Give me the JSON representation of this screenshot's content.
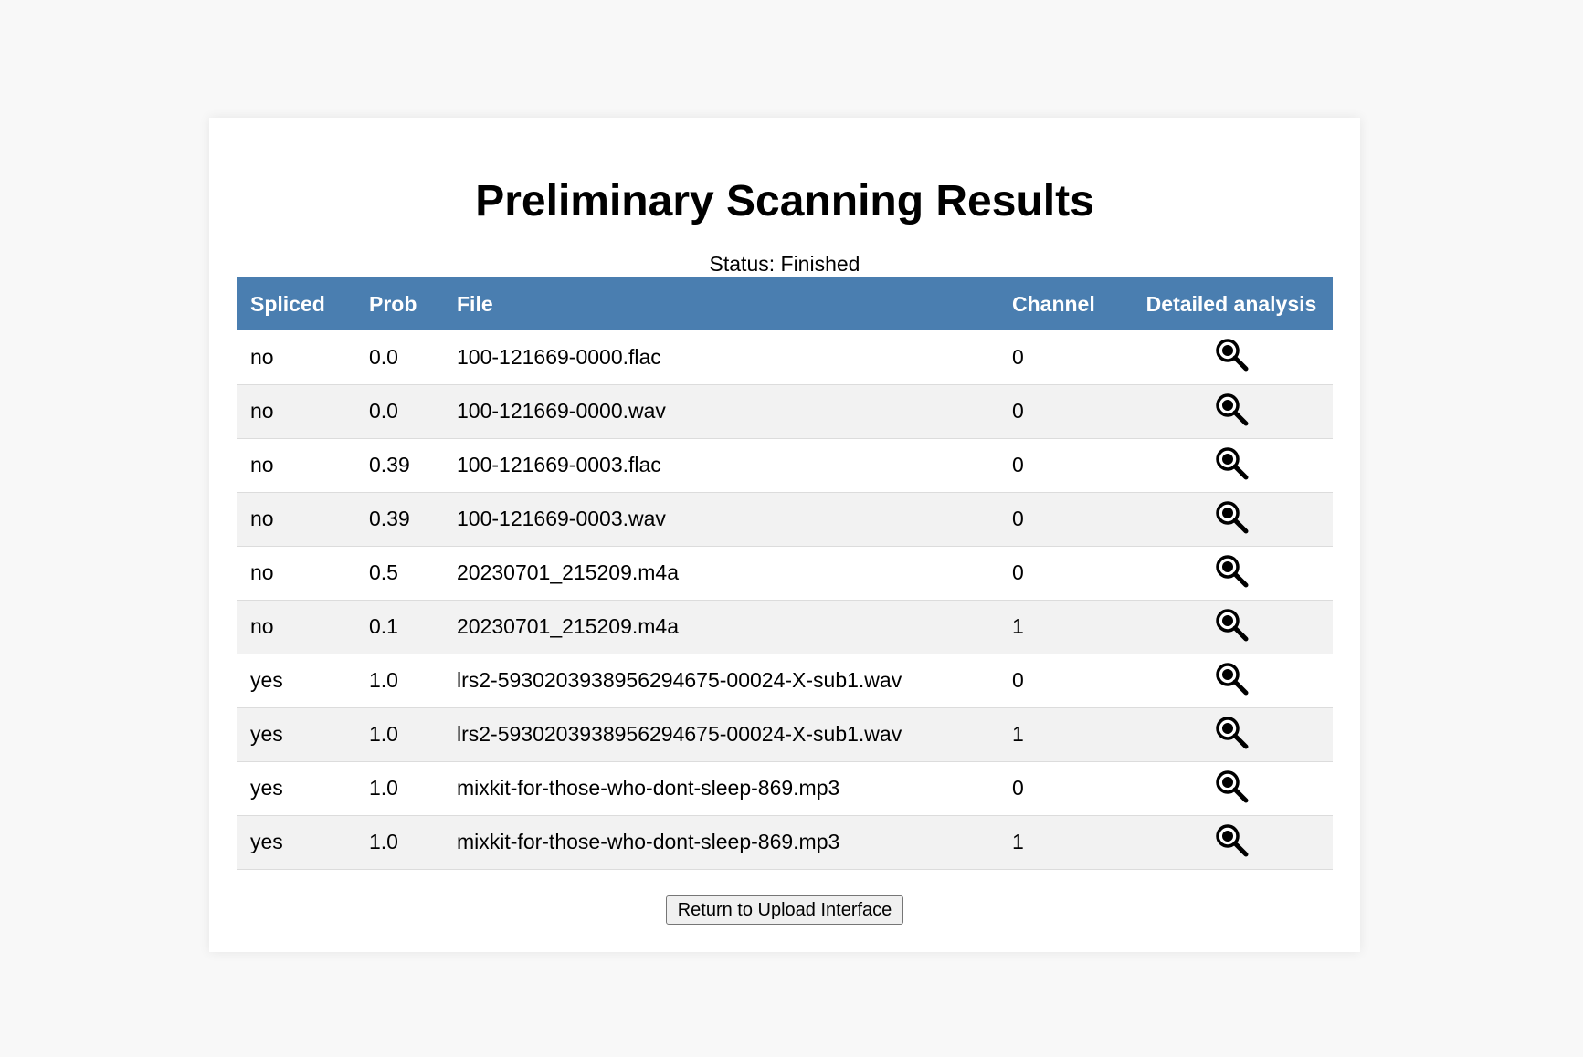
{
  "page": {
    "title": "Preliminary Scanning Results",
    "status": "Status: Finished"
  },
  "table": {
    "headers": {
      "spliced": "Spliced",
      "prob": "Prob",
      "file": "File",
      "channel": "Channel",
      "detailed": "Detailed analysis"
    },
    "rows": [
      {
        "spliced": "no",
        "prob": "0.0",
        "file": "100-121669-0000.flac",
        "channel": "0",
        "icon": "magnifier-icon"
      },
      {
        "spliced": "no",
        "prob": "0.0",
        "file": "100-121669-0000.wav",
        "channel": "0",
        "icon": "magnifier-icon"
      },
      {
        "spliced": "no",
        "prob": "0.39",
        "file": "100-121669-0003.flac",
        "channel": "0",
        "icon": "magnifier-icon"
      },
      {
        "spliced": "no",
        "prob": "0.39",
        "file": "100-121669-0003.wav",
        "channel": "0",
        "icon": "magnifier-icon"
      },
      {
        "spliced": "no",
        "prob": "0.5",
        "file": "20230701_215209.m4a",
        "channel": "0",
        "icon": "magnifier-icon"
      },
      {
        "spliced": "no",
        "prob": "0.1",
        "file": "20230701_215209.m4a",
        "channel": "1",
        "icon": "magnifier-icon"
      },
      {
        "spliced": "yes",
        "prob": "1.0",
        "file": "lrs2-5930203938956294675-00024-X-sub1.wav",
        "channel": "0",
        "icon": "magnifier-icon"
      },
      {
        "spliced": "yes",
        "prob": "1.0",
        "file": "lrs2-5930203938956294675-00024-X-sub1.wav",
        "channel": "1",
        "icon": "magnifier-icon"
      },
      {
        "spliced": "yes",
        "prob": "1.0",
        "file": "mixkit-for-those-who-dont-sleep-869.mp3",
        "channel": "0",
        "icon": "magnifier-icon"
      },
      {
        "spliced": "yes",
        "prob": "1.0",
        "file": "mixkit-for-those-who-dont-sleep-869.mp3",
        "channel": "1",
        "icon": "magnifier-icon"
      }
    ]
  },
  "actions": {
    "return_label": "Return to Upload Interface"
  },
  "colors": {
    "header_bg": "#4a7eb0",
    "header_text": "#ffffff",
    "row_alt_bg": "#f2f2f2",
    "page_bg": "#f8f8f8"
  }
}
